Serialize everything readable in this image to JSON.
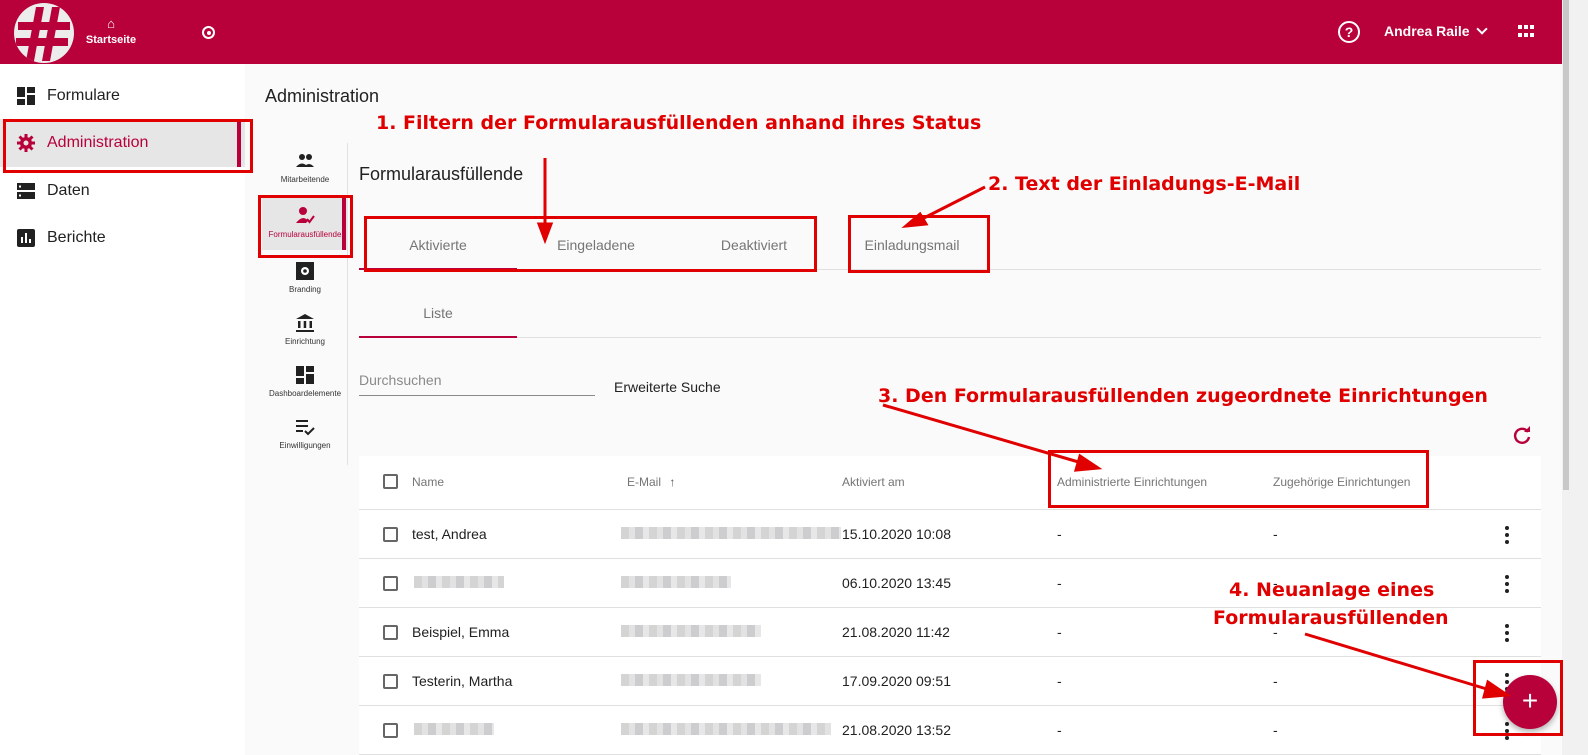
{
  "topbar": {
    "home_label": "Startseite",
    "user_name": "Andrea Raile",
    "icons": [
      "logo-hash",
      "home-icon",
      "radio-icon",
      "help-icon",
      "chevron-down-icon",
      "apps-grid-icon"
    ],
    "brand_color": "#b8003a"
  },
  "sidebar": {
    "items": [
      {
        "label": "Formulare",
        "icon": "dashboard-icon"
      },
      {
        "label": "Administration",
        "icon": "gear-icon",
        "active": true
      },
      {
        "label": "Daten",
        "icon": "storage-icon"
      },
      {
        "label": "Berichte",
        "icon": "chart-icon"
      }
    ]
  },
  "main": {
    "title": "Administration",
    "subnav": [
      {
        "label": "Mitarbeitende",
        "icon": "people-icon"
      },
      {
        "label": "Formularausfüllende",
        "icon": "person-check-icon",
        "active": true
      },
      {
        "label": "Branding",
        "icon": "gear-box-icon"
      },
      {
        "label": "Einrichtung",
        "icon": "institution-icon"
      },
      {
        "label": "Dashboardelemente",
        "icon": "dashboard-icon"
      },
      {
        "label": "Einwilligungen",
        "icon": "list-check-icon"
      }
    ],
    "section_title": "Formularausfüllende",
    "tabs": [
      {
        "label": "Aktivierte",
        "active": true
      },
      {
        "label": "Eingeladene"
      },
      {
        "label": "Deaktiviert"
      },
      {
        "label": "Einladungsmail"
      }
    ],
    "subtabs": [
      {
        "label": "Liste",
        "active": true
      }
    ],
    "search": {
      "placeholder": "Durchsuchen",
      "value": ""
    },
    "advanced_search_label": "Erweiterte Suche"
  },
  "table": {
    "columns": [
      "Name",
      "E-Mail",
      "Aktiviert am",
      "Administrierte Einrichtungen",
      "Zugehörige Einrichtungen"
    ],
    "sort": {
      "column": "E-Mail",
      "direction": "asc"
    },
    "rows": [
      {
        "name": "test, Andrea",
        "email": "[redacted]",
        "activated": "15.10.2020 10:08",
        "admin": "-",
        "member": "-"
      },
      {
        "name": "[redacted]",
        "email": "[redacted]",
        "activated": "06.10.2020 13:45",
        "admin": "-",
        "member": "-"
      },
      {
        "name": "Beispiel, Emma",
        "email": "[redacted]",
        "activated": "21.08.2020 11:42",
        "admin": "-",
        "member": "-"
      },
      {
        "name": "Testerin, Martha",
        "email": "[redacted]",
        "activated": "17.09.2020 09:51",
        "admin": "-",
        "member": "-"
      },
      {
        "name": "[redacted]",
        "email": "[redacted]",
        "activated": "21.08.2020 13:52",
        "admin": "-",
        "member": "-"
      }
    ]
  },
  "fab_label": "+",
  "annotations": {
    "a1": "1. Filtern der Formularausfüllenden anhand ihres Status",
    "a2": "2. Text der Einladungs-E-Mail",
    "a3": "3. Den Formularausfüllenden zugeordnete Einrichtungen",
    "a4_line1": "4. Neuanlage eines",
    "a4_line2": "Formularausfüllenden",
    "color": "#e00000"
  }
}
